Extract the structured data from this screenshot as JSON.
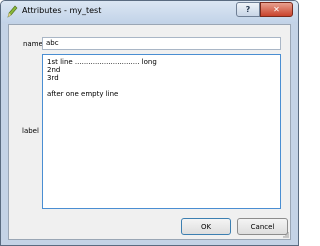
{
  "window": {
    "title": "Attributes - my_test",
    "help_glyph": "?",
    "close_glyph": "✕"
  },
  "form": {
    "name_label": "name",
    "name_value": "abc",
    "label_label": "label",
    "label_lines": [
      "1st line ............................. long",
      "2nd",
      "3rd",
      "",
      "after one empty line"
    ]
  },
  "buttons": {
    "ok": "OK",
    "cancel": "Cancel"
  },
  "icons": {
    "app": "pencil-icon",
    "help": "help-icon",
    "close": "close-icon",
    "resize": "resize-grip-icon"
  }
}
